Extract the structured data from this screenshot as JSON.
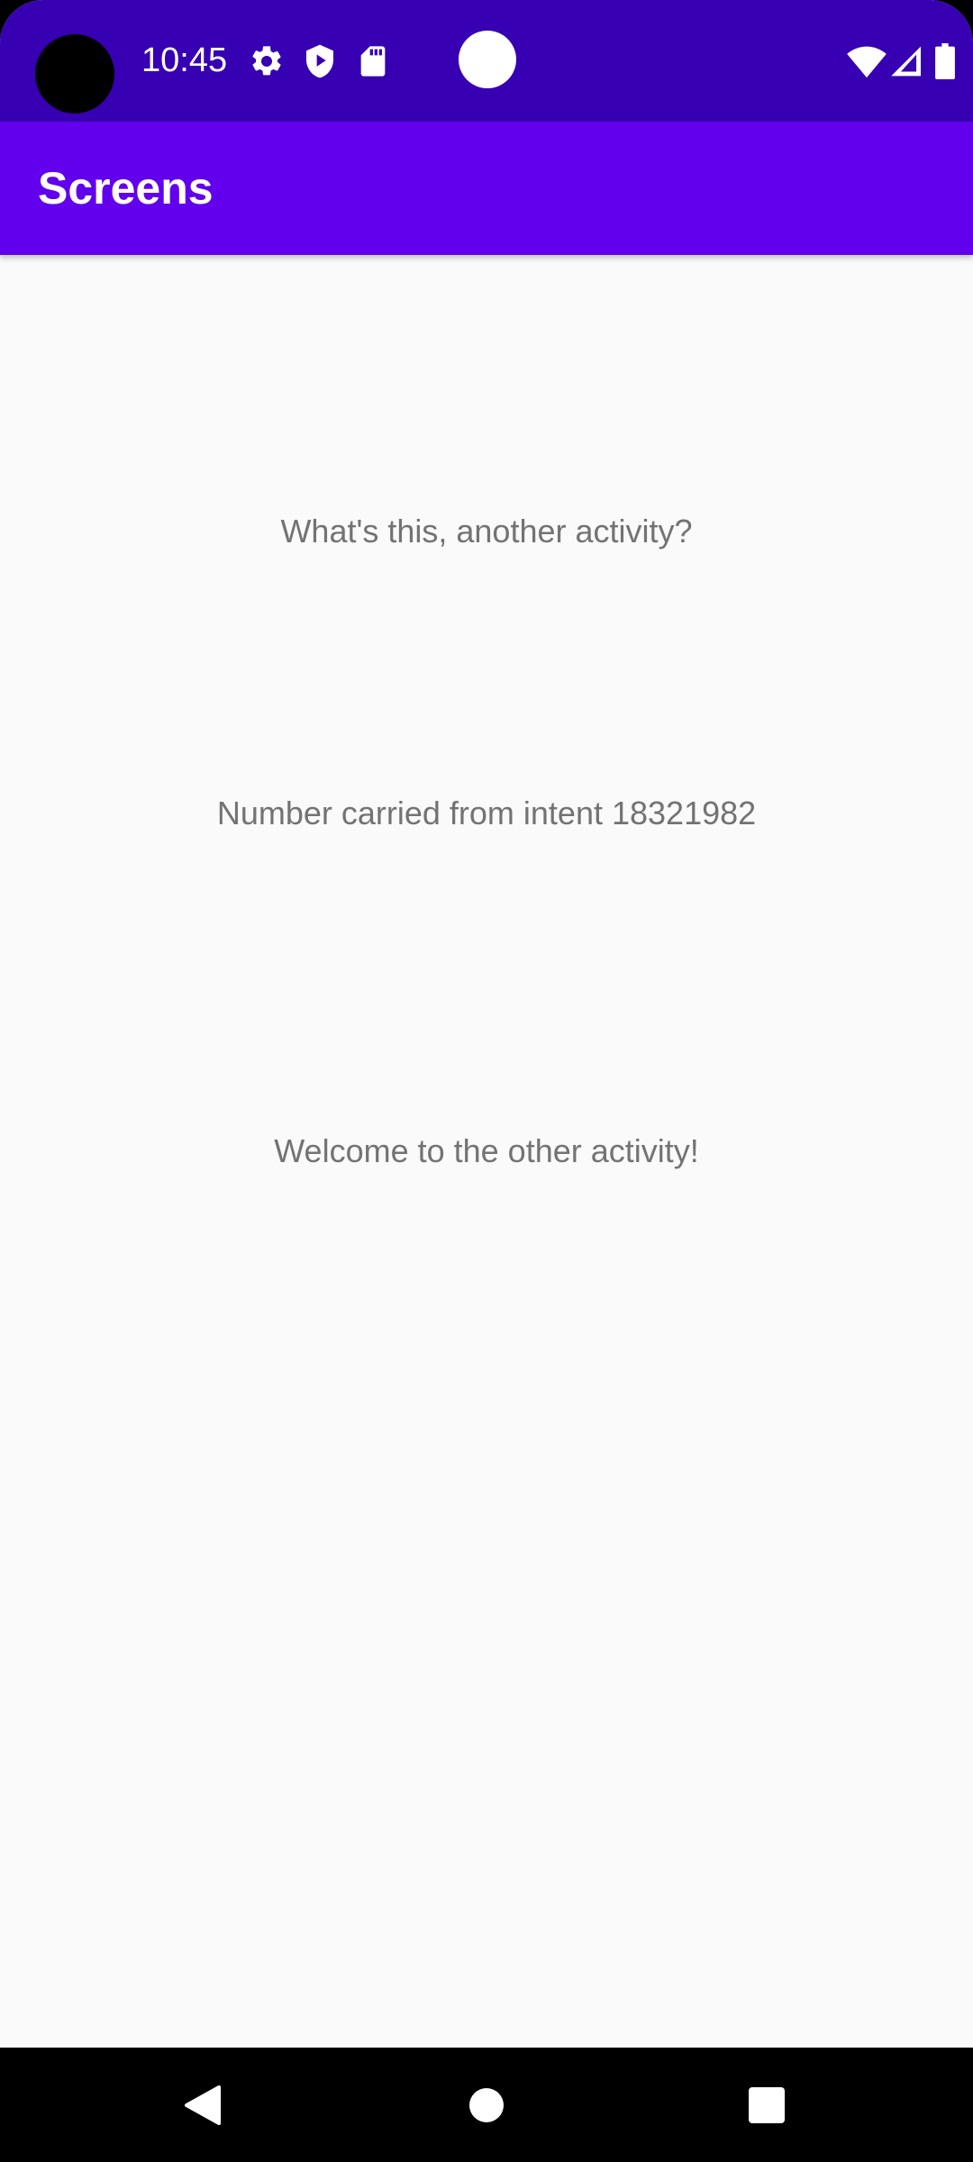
{
  "status_bar": {
    "time": "10:45",
    "background": "#3700b3",
    "left_icons": [
      "settings-icon",
      "shield-play-icon",
      "sd-card-icon"
    ],
    "right_icons": [
      "wifi-icon",
      "cellular-signal-icon",
      "battery-icon"
    ]
  },
  "app_bar": {
    "title": "Screens",
    "background": "#6200ee"
  },
  "content": {
    "line1": "What's this, another activity?",
    "line2": "Number carried from intent 18321982",
    "line3": "Welcome to the other activity!",
    "text_color": "#737373",
    "background": "#fafafa"
  },
  "nav_bar": {
    "buttons": [
      "back-icon",
      "home-icon",
      "recents-icon"
    ]
  }
}
